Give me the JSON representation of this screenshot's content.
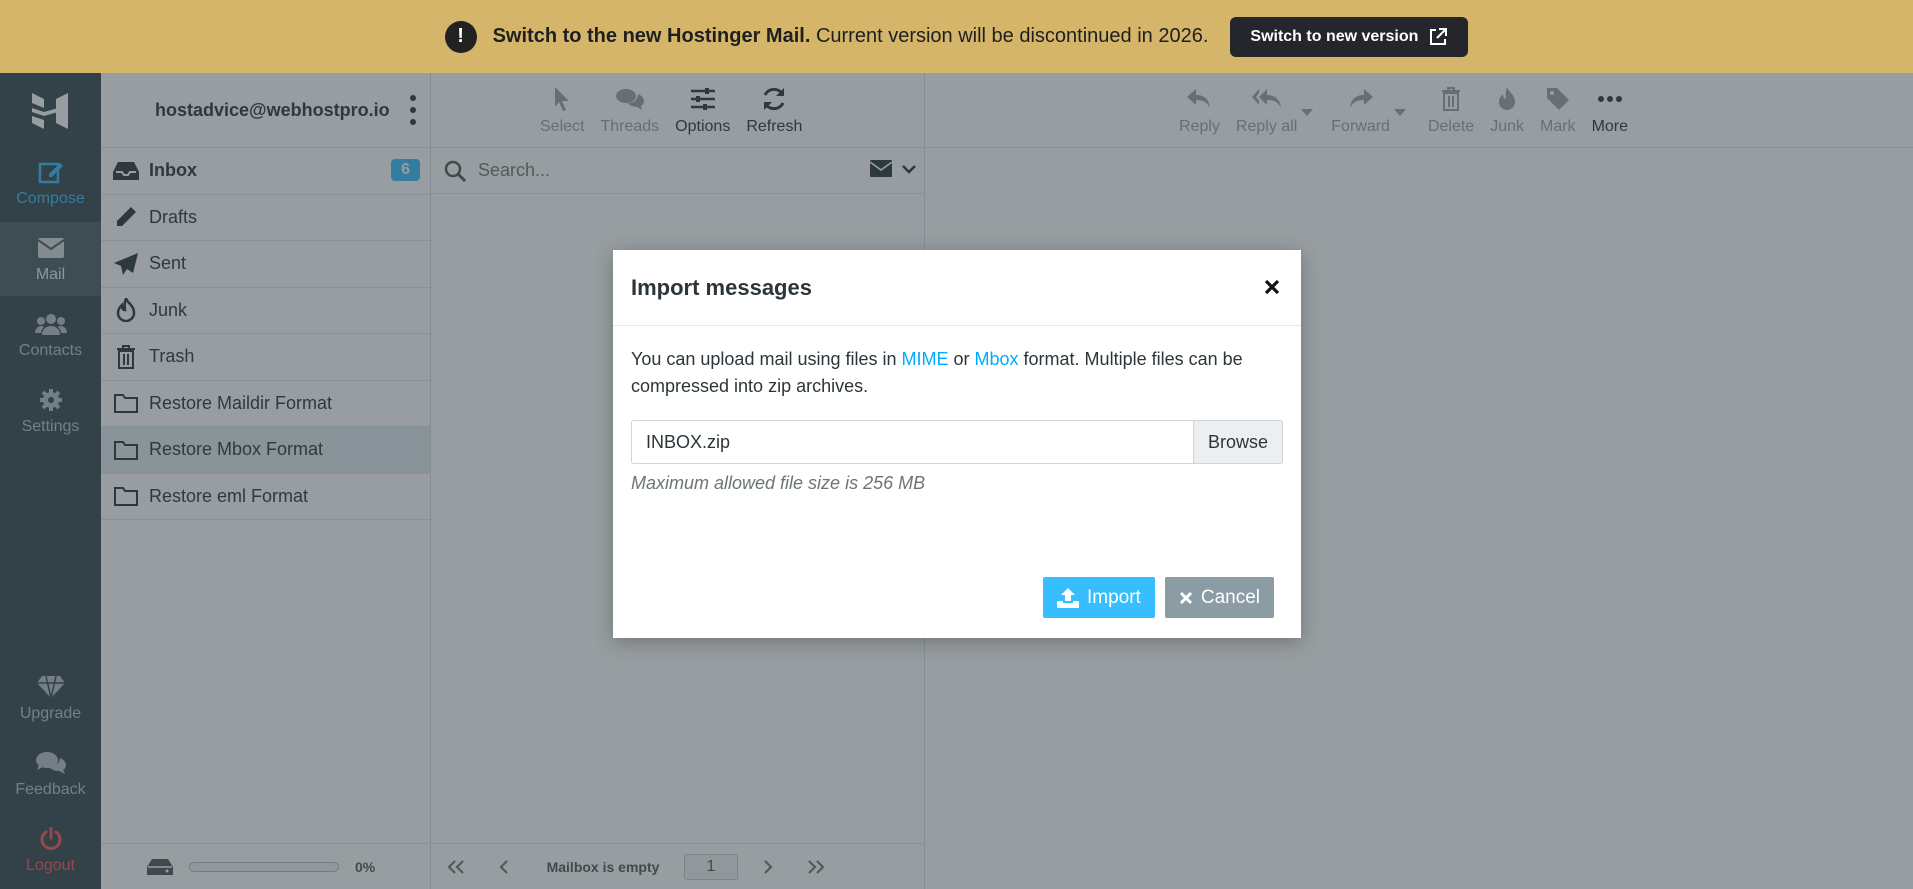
{
  "banner": {
    "headline": "Switch to the new Hostinger Mail.",
    "message": " Current version will be discontinued in 2026.",
    "button_label": "Switch to new version"
  },
  "rail": {
    "compose": "Compose",
    "mail": "Mail",
    "contacts": "Contacts",
    "settings": "Settings",
    "upgrade": "Upgrade",
    "feedback": "Feedback",
    "logout": "Logout"
  },
  "account": {
    "email": "hostadvice@webhostpro.io"
  },
  "folders": [
    {
      "label": "Inbox",
      "badge": "6"
    },
    {
      "label": "Drafts"
    },
    {
      "label": "Sent"
    },
    {
      "label": "Junk"
    },
    {
      "label": "Trash"
    },
    {
      "label": "Restore Maildir Format"
    },
    {
      "label": "Restore Mbox Format"
    },
    {
      "label": "Restore eml Format"
    }
  ],
  "quota": {
    "percent_label": "0%",
    "fraction": 0
  },
  "list_toolbar": {
    "select": "Select",
    "threads": "Threads",
    "options": "Options",
    "refresh": "Refresh"
  },
  "search": {
    "placeholder": "Search..."
  },
  "pager": {
    "status": "Mailbox is empty",
    "page": "1"
  },
  "message_toolbar": {
    "reply": "Reply",
    "reply_all": "Reply all",
    "forward": "Forward",
    "delete": "Delete",
    "junk": "Junk",
    "mark": "Mark",
    "more": "More"
  },
  "dialog": {
    "title": "Import messages",
    "text_before": "You can upload mail using files in ",
    "link_mime": "MIME",
    "text_or": " or ",
    "link_mbox": "Mbox",
    "text_after": " format. Multiple files can be compressed into zip archives.",
    "file_value": "INBOX.zip",
    "browse_label": "Browse",
    "hint": "Maximum allowed file size is 256 MB",
    "import_label": "Import",
    "cancel_label": "Cancel"
  },
  "colors": {
    "banner": "#d4b56a",
    "rail": "#37474f",
    "accent": "#37beff",
    "logout": "#ff5552"
  }
}
